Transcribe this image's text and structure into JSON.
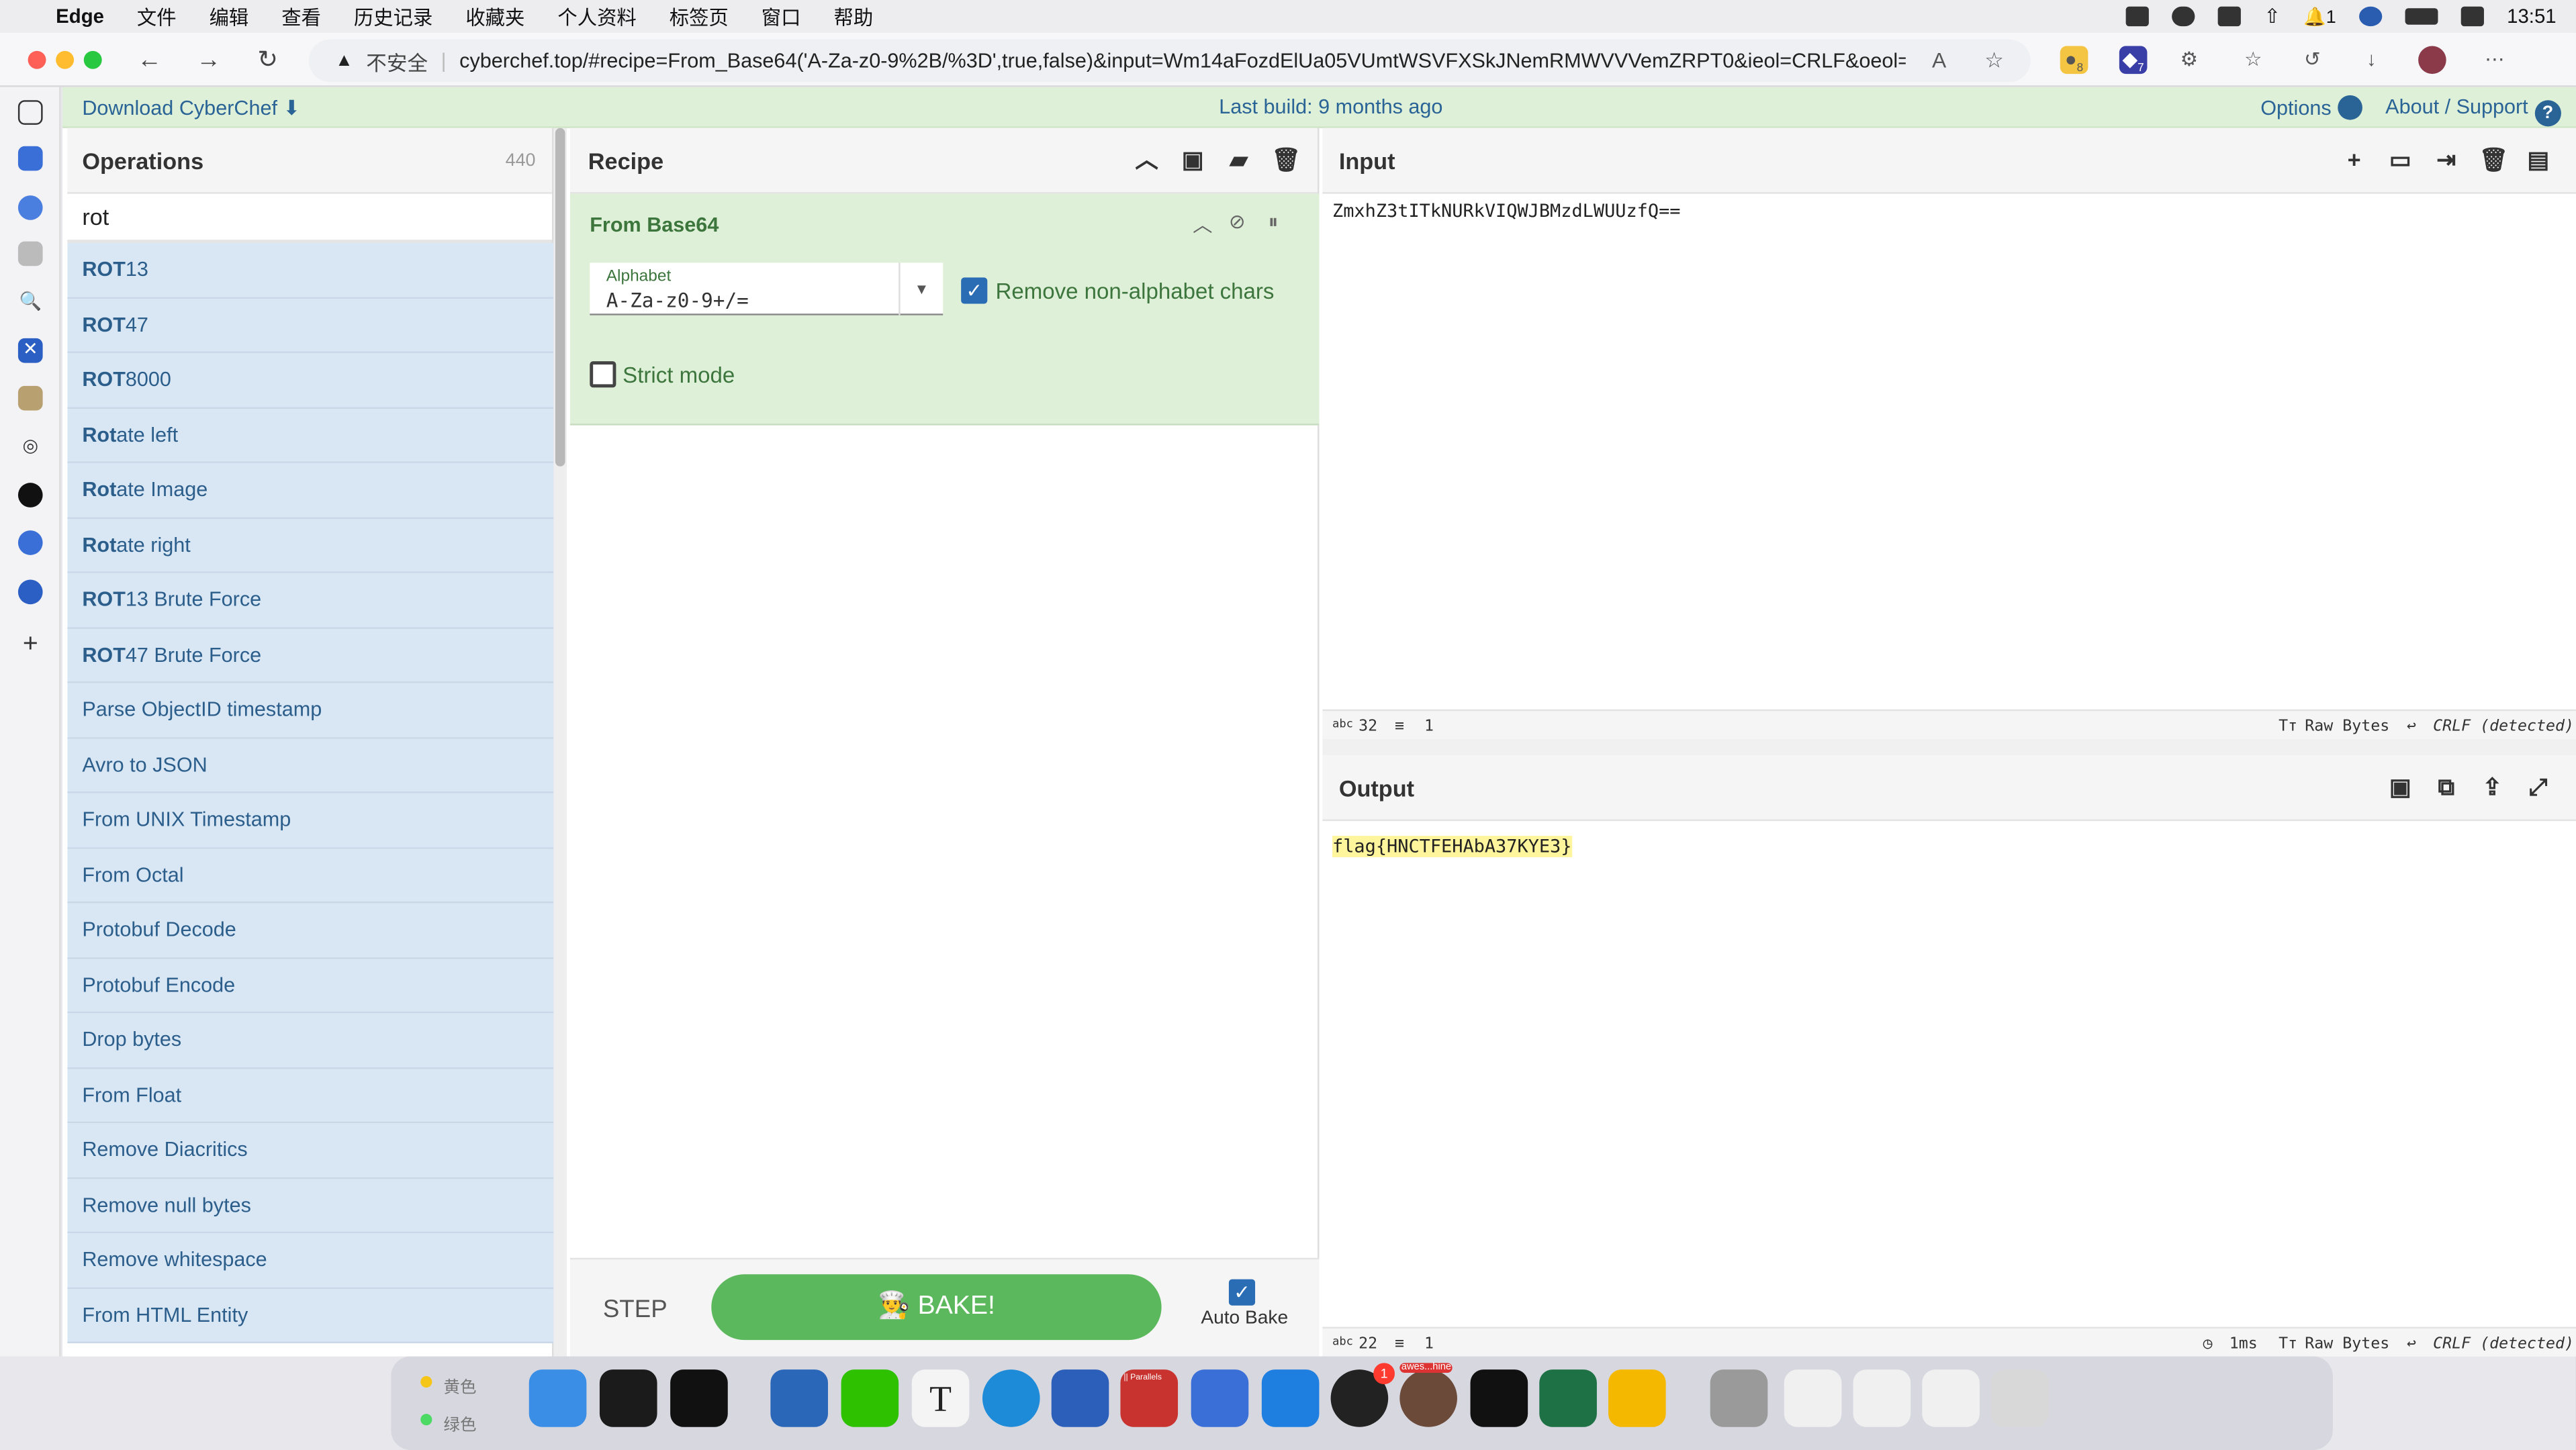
{
  "menubar": {
    "app_name": "Edge",
    "items": [
      "文件",
      "编辑",
      "查看",
      "历史记录",
      "收藏夹",
      "个人资料",
      "标签页",
      "窗口",
      "帮助"
    ],
    "notification_count": "1",
    "clock": "13:51"
  },
  "browser": {
    "security_label": "不安全",
    "url": "cyberchef.top/#recipe=From_Base64('A-Za-z0-9%2B/%3D',true,false)&input=Wm14aFozdElUa05VUmtWSVFXSkJNemRMWVVVemZRPT0&ieol=CRLF&oeol=CRLF",
    "badge_1": "8",
    "badge_2": "7"
  },
  "banner": {
    "download": "Download CyberChef",
    "last_build": "Last build: 9 months ago",
    "options": "Options",
    "about": "About / Support"
  },
  "operations": {
    "title": "Operations",
    "count": "440",
    "search_value": "rot",
    "items": [
      {
        "bold": "ROT",
        "rest": "13"
      },
      {
        "bold": "ROT",
        "rest": "47"
      },
      {
        "bold": "ROT",
        "rest": "8000"
      },
      {
        "bold": "Rot",
        "rest": "ate left"
      },
      {
        "bold": "Rot",
        "rest": "ate Image"
      },
      {
        "bold": "Rot",
        "rest": "ate right"
      },
      {
        "bold": "ROT",
        "rest": "13 Brute Force"
      },
      {
        "bold": "ROT",
        "rest": "47 Brute Force"
      },
      {
        "bold": "",
        "rest": "Parse ObjectID timestamp"
      },
      {
        "bold": "",
        "rest": "Avro to JSON"
      },
      {
        "bold": "",
        "rest": "From UNIX Timestamp"
      },
      {
        "bold": "",
        "rest": "From Octal"
      },
      {
        "bold": "",
        "rest": "Protobuf Decode"
      },
      {
        "bold": "",
        "rest": "Protobuf Encode"
      },
      {
        "bold": "",
        "rest": "Drop bytes"
      },
      {
        "bold": "",
        "rest": "From Float"
      },
      {
        "bold": "",
        "rest": "Remove Diacritics"
      },
      {
        "bold": "",
        "rest": "Remove null bytes"
      },
      {
        "bold": "",
        "rest": "Remove whitespace"
      },
      {
        "bold": "",
        "rest": "From HTML Entity"
      }
    ]
  },
  "recipe": {
    "title": "Recipe",
    "op_title": "From Base64",
    "alphabet_label": "Alphabet",
    "alphabet_value": "A-Za-z0-9+/=",
    "remove_nonalpha_label": "Remove non-alphabet chars",
    "remove_nonalpha_checked": true,
    "strict_label": "Strict mode",
    "strict_checked": false,
    "step_label": "STEP",
    "bake_label": "BAKE!",
    "autobake_label": "Auto Bake"
  },
  "input": {
    "title": "Input",
    "text": "ZmxhZ3tITkNURkVIQWJBMzdLWUUzfQ==",
    "length": "32",
    "lines": "1",
    "format": "Raw Bytes",
    "eol": "CRLF (detected)"
  },
  "output": {
    "title": "Output",
    "text": "flag{HNCTFEHAbA37KYE3}",
    "length": "22",
    "lines": "1",
    "time": "1ms",
    "format": "Raw Bytes",
    "eol": "CRLF (detected)"
  },
  "dock": {
    "tag_yellow": "黄色",
    "tag_green": "绿色",
    "qq_badge": "1",
    "tooltip": "awes...hine",
    "parallels_label": "|| Parallels"
  },
  "colors": {
    "banner_bg": "#dff0d8",
    "op_bg": "#d9e7f4",
    "bake_green": "#5cb85c",
    "highlight": "#fff59d"
  }
}
